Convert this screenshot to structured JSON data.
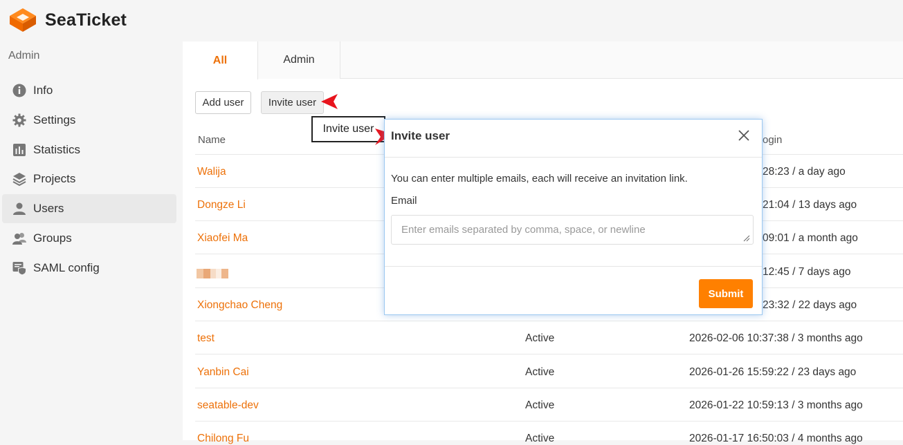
{
  "header": {
    "brand": "SeaTicket"
  },
  "sidebar": {
    "title": "Admin",
    "items": [
      {
        "label": "Info",
        "icon": "info-icon",
        "active": false
      },
      {
        "label": "Settings",
        "icon": "gear-icon",
        "active": false
      },
      {
        "label": "Statistics",
        "icon": "statistics-icon",
        "active": false
      },
      {
        "label": "Projects",
        "icon": "layers-icon",
        "active": false
      },
      {
        "label": "Users",
        "icon": "user-icon",
        "active": true
      },
      {
        "label": "Groups",
        "icon": "groups-icon",
        "active": false
      },
      {
        "label": "SAML config",
        "icon": "saml-icon",
        "active": false
      }
    ]
  },
  "tabs": {
    "all": "All",
    "admin": "Admin"
  },
  "toolbar": {
    "add_user": "Add user",
    "invite_user": "Invite user"
  },
  "tooltip": "Invite user",
  "table": {
    "headers": {
      "name": "Name",
      "last_login": "ogin"
    },
    "rows": [
      {
        "name": "Walija",
        "status": "",
        "last_login": "28:23 / a day ago"
      },
      {
        "name": "Dongze Li",
        "status": "",
        "last_login": "21:04 / 13 days ago"
      },
      {
        "name": "Xiaofei Ma",
        "status": "",
        "last_login": "09:01 / a month ago"
      },
      {
        "name": "",
        "status": "",
        "last_login": "12:45 / 7 days ago"
      },
      {
        "name": "Xiongchao Cheng",
        "status": "",
        "last_login": "23:32 / 22 days ago"
      },
      {
        "name": "test",
        "status": "Active",
        "last_login": "2026-02-06 10:37:38 / 3 months ago"
      },
      {
        "name": "Yanbin Cai",
        "status": "Active",
        "last_login": "2026-01-26 15:59:22 / 23 days ago"
      },
      {
        "name": "seatable-dev",
        "status": "Active",
        "last_login": "2026-01-22 10:59:13 / 3 months ago"
      },
      {
        "name": "Chilong Fu",
        "status": "Active",
        "last_login": "2026-01-17 16:50:03 / 4 months ago"
      }
    ]
  },
  "modal": {
    "title": "Invite user",
    "description": "You can enter multiple emails, each will receive an invitation link.",
    "email_label": "Email",
    "email_placeholder": "Enter emails separated by comma, space, or newline",
    "email_value": "",
    "submit": "Submit"
  },
  "colors": {
    "accent": "#ed7109",
    "submit": "#ff8000",
    "annotation_arrow": "#e8141d"
  }
}
